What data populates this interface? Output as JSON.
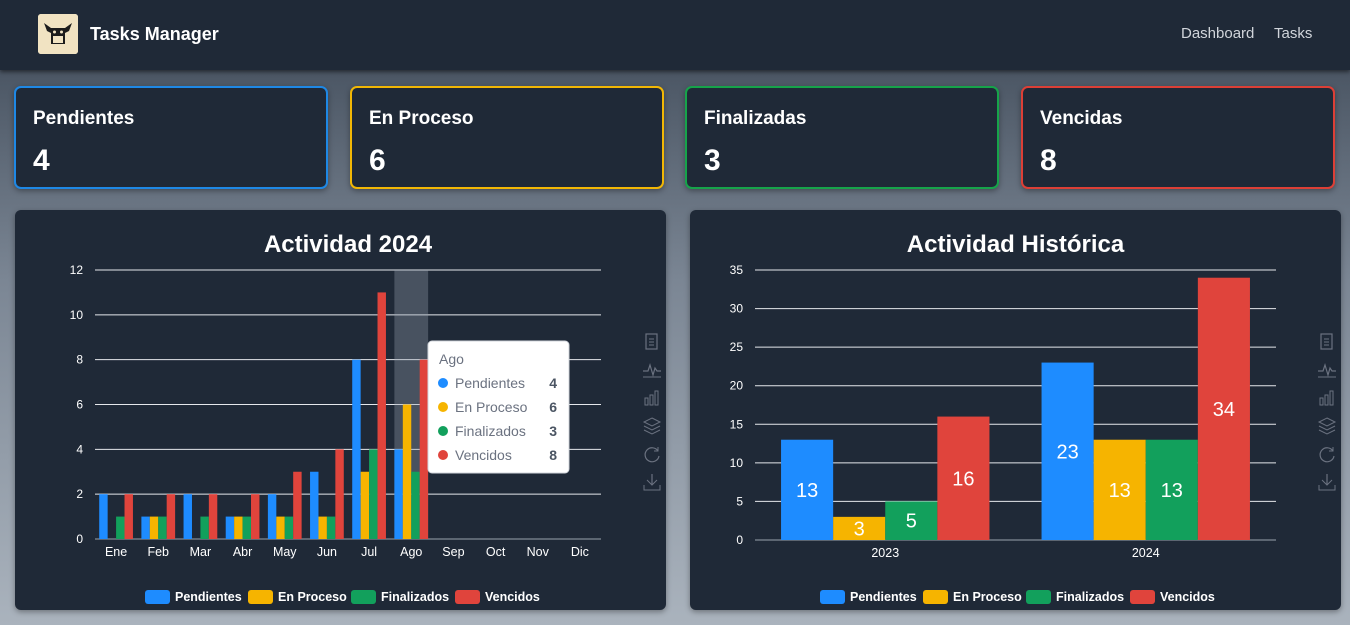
{
  "navbar": {
    "brand": "Tasks Manager",
    "links": [
      "Dashboard",
      "Tasks"
    ]
  },
  "cards": [
    {
      "label": "Pendientes",
      "value": "4",
      "color": "#1e88e5"
    },
    {
      "label": "En Proceso",
      "value": "6",
      "color": "#f2b705"
    },
    {
      "label": "Finalizadas",
      "value": "3",
      "color": "#16a34a"
    },
    {
      "label": "Vencidas",
      "value": "8",
      "color": "#dc3f36"
    }
  ],
  "colors": {
    "Pendientes": "#1e8cff",
    "En Proceso": "#f6b400",
    "Finalizados": "#12a05c",
    "Vencidos": "#e0443c",
    "panel": "#1f2937",
    "navbar": "#1f2937"
  },
  "toolbox_icons": [
    "data-view-icon",
    "line-chart-icon",
    "bar-chart-icon",
    "stack-icon",
    "restore-icon",
    "download-icon"
  ],
  "tooltip": {
    "title": "Ago",
    "rows": [
      {
        "name": "Pendientes",
        "value": "4"
      },
      {
        "name": "En Proceso",
        "value": "6"
      },
      {
        "name": "Finalizados",
        "value": "3"
      },
      {
        "name": "Vencidos",
        "value": "8"
      }
    ]
  },
  "chart_data": [
    {
      "type": "bar",
      "title": "Actividad 2024",
      "categories": [
        "Ene",
        "Feb",
        "Mar",
        "Abr",
        "May",
        "Jun",
        "Jul",
        "Ago",
        "Sep",
        "Oct",
        "Nov",
        "Dic"
      ],
      "ylim": [
        0,
        12
      ],
      "yticks": [
        0,
        2,
        4,
        6,
        8,
        10,
        12
      ],
      "grid": true,
      "legend_position": "bottom",
      "highlighted_category": "Ago",
      "series": [
        {
          "name": "Pendientes",
          "values": [
            2,
            1,
            2,
            1,
            2,
            3,
            8,
            4,
            0,
            0,
            0,
            0
          ]
        },
        {
          "name": "En Proceso",
          "values": [
            0,
            1,
            0,
            1,
            1,
            1,
            3,
            6,
            0,
            0,
            0,
            0
          ]
        },
        {
          "name": "Finalizados",
          "values": [
            1,
            1,
            1,
            1,
            1,
            1,
            4,
            3,
            0,
            0,
            0,
            0
          ]
        },
        {
          "name": "Vencidos",
          "values": [
            2,
            2,
            2,
            2,
            3,
            4,
            11,
            8,
            0,
            0,
            0,
            0
          ]
        }
      ]
    },
    {
      "type": "bar",
      "title": "Actividad Histórica",
      "categories": [
        "2023",
        "2024"
      ],
      "ylim": [
        0,
        35
      ],
      "yticks": [
        0,
        5,
        10,
        15,
        20,
        25,
        30,
        35
      ],
      "grid": true,
      "legend_position": "bottom",
      "data_labels": true,
      "series": [
        {
          "name": "Pendientes",
          "values": [
            13,
            23
          ]
        },
        {
          "name": "En Proceso",
          "values": [
            3,
            13
          ]
        },
        {
          "name": "Finalizados",
          "values": [
            5,
            13
          ]
        },
        {
          "name": "Vencidos",
          "values": [
            16,
            34
          ]
        }
      ]
    }
  ]
}
